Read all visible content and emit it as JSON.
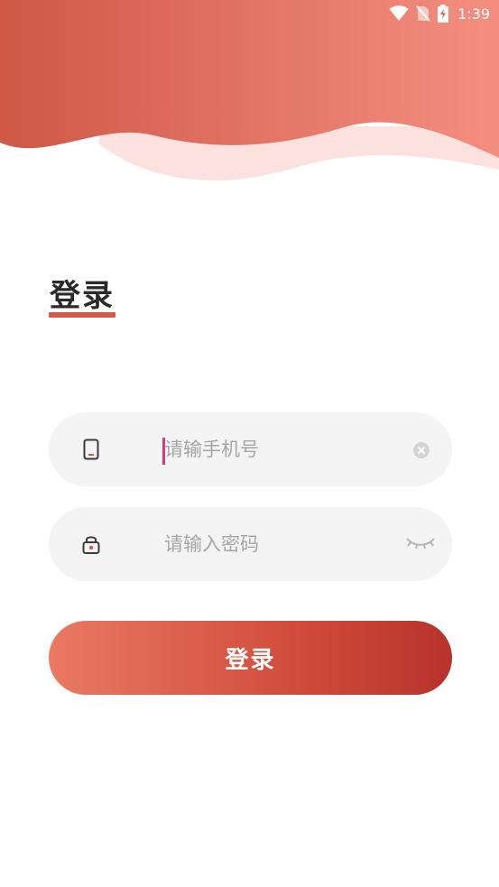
{
  "status_bar": {
    "time": "1:39",
    "icons": [
      "wifi-icon",
      "no-sim-icon",
      "battery-charging-icon"
    ]
  },
  "colors": {
    "accent": "#d35a4b",
    "header_dark": "#d0594a",
    "header_light": "#f38e7f",
    "wave_light": "#fbe2df",
    "field_bg": "#f4f4f4",
    "caret": "#d63a7a",
    "button_start": "#e97a63",
    "button_end": "#b7332b"
  },
  "login": {
    "title": "登录",
    "phone_placeholder": "请输手机号",
    "password_placeholder": "请输入密码",
    "submit_label": "登录",
    "phone_icon": "phone-icon",
    "lock_icon": "lock-icon",
    "clear_icon": "clear-icon",
    "visibility_icon": "eye-closed-icon"
  }
}
